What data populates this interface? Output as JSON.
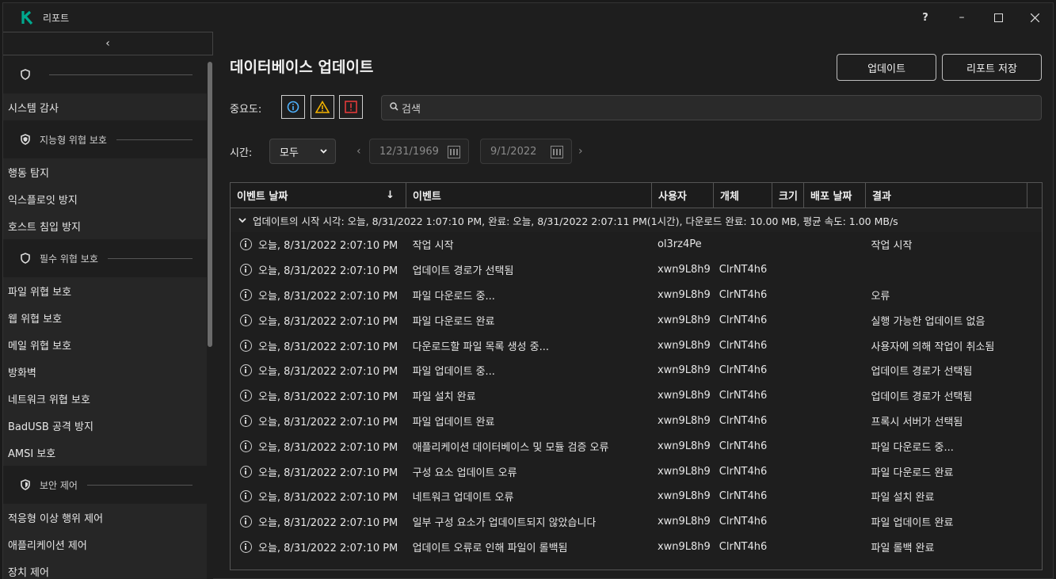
{
  "app": {
    "title": "리포트"
  },
  "window_controls": {
    "help": "?",
    "minimize": "–",
    "maximize": "☐",
    "close": "✕"
  },
  "sidebar": {
    "collapse": "‹",
    "sections": [
      {
        "head": "",
        "items": [
          "시스템 감사"
        ]
      },
      {
        "head": "지능형 위협 보호",
        "items": [
          "행동 탐지",
          "익스플로잇 방지",
          "호스트 침입 방지"
        ]
      },
      {
        "head": "필수 위협 보호",
        "items": [
          "파일 위협 보호",
          "웹 위협 보호",
          "메일 위협 보호",
          "방화벽",
          "네트워크 위협 보호",
          "BadUSB 공격 방지",
          "AMSI 보호"
        ]
      },
      {
        "head": "보안 제어",
        "items": [
          "적응형 이상 행위 제어",
          "애플리케이션 제어",
          "장치 제어"
        ]
      }
    ]
  },
  "main": {
    "title": "데이터베이스 업데이트",
    "update_button": "업데이트",
    "save_button": "리포트 저장",
    "severity_label": "중요도:",
    "search_placeholder": "검색",
    "time_label": "시간:",
    "time_select": "모두",
    "date_from": "12/31/1969",
    "date_to": "9/1/2022"
  },
  "table": {
    "columns": [
      "이벤트 날짜",
      "이벤트",
      "사용자",
      "개체",
      "크기",
      "배포 날짜",
      "결과"
    ],
    "group": "업데이트의 시작 시각: 오늘, 8/31/2022 1:07:10 PM, 완료: 오늘, 8/31/2022 2:07:11 PM(1시간), 다운로드 완료: 10.00 MB, 평균 속도: 1.00 MB/s",
    "rows": [
      {
        "date": "오늘, 8/31/2022 2:07:10 PM",
        "event": "작업 시작",
        "user": "ol3rz4Pe",
        "object": "",
        "size": "",
        "dist": "",
        "result": "작업 시작"
      },
      {
        "date": "오늘, 8/31/2022 2:07:10 PM",
        "event": "업데이트 경로가 선택됨",
        "user": "xwn9L8h9",
        "object": "ClrNT4h6",
        "size": "",
        "dist": "",
        "result": ""
      },
      {
        "date": "오늘, 8/31/2022 2:07:10 PM",
        "event": "파일 다운로드 중...",
        "user": "xwn9L8h9",
        "object": "ClrNT4h6",
        "size": "",
        "dist": "",
        "result": "오류"
      },
      {
        "date": "오늘, 8/31/2022 2:07:10 PM",
        "event": "파일 다운로드 완료",
        "user": "xwn9L8h9",
        "object": "ClrNT4h6",
        "size": "",
        "dist": "",
        "result": "실행 가능한 업데이트 없음"
      },
      {
        "date": "오늘, 8/31/2022 2:07:10 PM",
        "event": "다운로드할 파일 목록 생성 중...",
        "user": "xwn9L8h9",
        "object": "ClrNT4h6",
        "size": "",
        "dist": "",
        "result": "사용자에 의해 작업이 취소됨"
      },
      {
        "date": "오늘, 8/31/2022 2:07:10 PM",
        "event": "파일 업데이트 중...",
        "user": "xwn9L8h9",
        "object": "ClrNT4h6",
        "size": "",
        "dist": "",
        "result": "업데이트 경로가 선택됨"
      },
      {
        "date": "오늘, 8/31/2022 2:07:10 PM",
        "event": "파일 설치 완료",
        "user": "xwn9L8h9",
        "object": "ClrNT4h6",
        "size": "",
        "dist": "",
        "result": "업데이트 경로가 선택됨"
      },
      {
        "date": "오늘, 8/31/2022 2:07:10 PM",
        "event": "파일 업데이트 완료",
        "user": "xwn9L8h9",
        "object": "ClrNT4h6",
        "size": "",
        "dist": "",
        "result": "프록시 서버가 선택됨"
      },
      {
        "date": "오늘, 8/31/2022 2:07:10 PM",
        "event": "애플리케이션 데이터베이스 및 모듈 검증 오류",
        "user": "xwn9L8h9",
        "object": "ClrNT4h6",
        "size": "",
        "dist": "",
        "result": "파일 다운로드 중..."
      },
      {
        "date": "오늘, 8/31/2022 2:07:10 PM",
        "event": "구성 요소 업데이트 오류",
        "user": "xwn9L8h9",
        "object": "ClrNT4h6",
        "size": "",
        "dist": "",
        "result": "파일 다운로드 완료"
      },
      {
        "date": "오늘, 8/31/2022 2:07:10 PM",
        "event": "네트워크 업데이트 오류",
        "user": "xwn9L8h9",
        "object": "ClrNT4h6",
        "size": "",
        "dist": "",
        "result": "파일 설치 완료"
      },
      {
        "date": "오늘, 8/31/2022 2:07:10 PM",
        "event": "일부 구성 요소가 업데이트되지 않았습니다",
        "user": "xwn9L8h9",
        "object": "ClrNT4h6",
        "size": "",
        "dist": "",
        "result": "파일 업데이트 완료"
      },
      {
        "date": "오늘, 8/31/2022 2:07:10 PM",
        "event": "업데이트 오류로 인해 파일이 롤백됨",
        "user": "xwn9L8h9",
        "object": "ClrNT4h6",
        "size": "",
        "dist": "",
        "result": "파일 롤백 완료"
      }
    ]
  },
  "colors": {
    "brand": "#00a88e",
    "warning": "#f5b400",
    "error": "#e03a3a",
    "info": "#4fb3ff"
  }
}
